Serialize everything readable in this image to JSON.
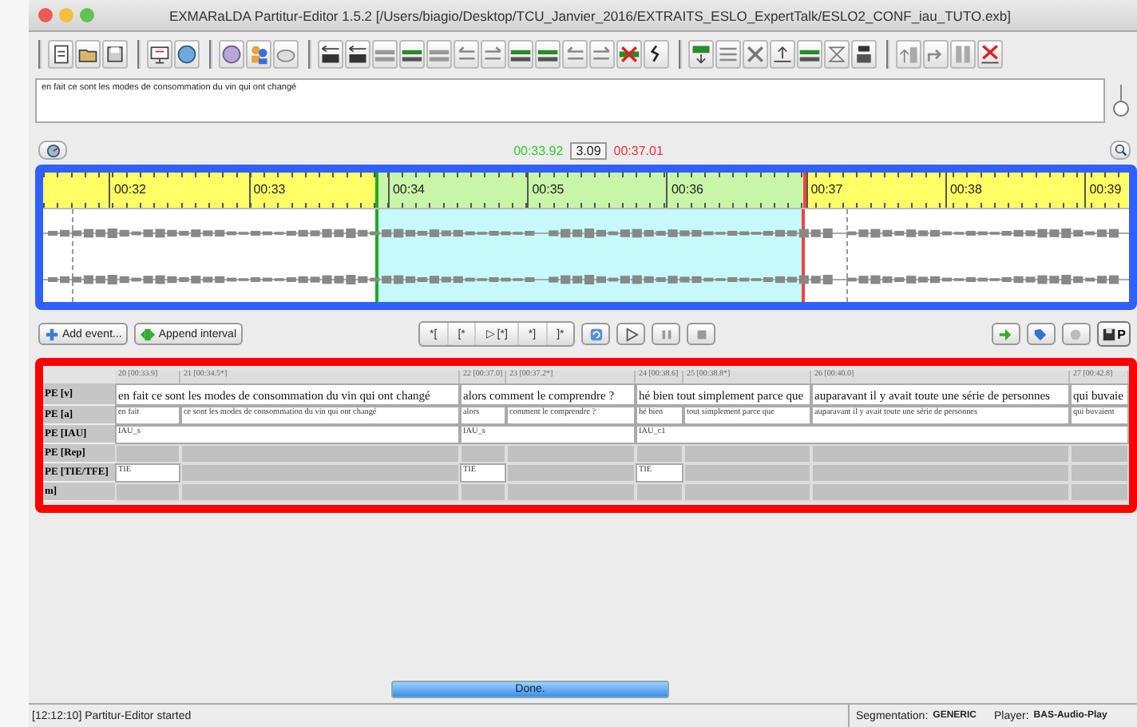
{
  "window": {
    "title": "EXMARaLDA Partitur-Editor 1.5.2 [/Users/biagio/Desktop/TCU_Janvier_2016/EXTRAITS_ESLO_ExpertTalk/ESLO2_CONF_iau_TUTO.exb]"
  },
  "transcript_field": {
    "value": "en fait ce sont les modes de consommation du vin qui ont changé"
  },
  "selection": {
    "start": "00:33.92",
    "length": "3.09",
    "end": "00:37.01"
  },
  "timeline": {
    "ticks": [
      "00:32",
      "00:33",
      "00:34",
      "00:35",
      "00:36",
      "00:37",
      "00:38",
      "00:39"
    ]
  },
  "buttons": [
    "Add event...",
    "Append interval"
  ],
  "segment_buttons": [
    "*[",
    "[*",
    "▷ [*]",
    "*]",
    "]*"
  ],
  "mode_button": {
    "label": "P"
  },
  "partitur": {
    "columns": [
      "20 [00:33.9]",
      "21 [00:34.5*]",
      "22 [00:37.0]",
      "23 [00:37.2*]",
      "24 [00:38.6]",
      "25 [00:38.8*]",
      "26 [00:40.0]",
      "27 [00:42.8]"
    ],
    "tiers": [
      {
        "label": "PE [v]",
        "kind": "large",
        "cells": [
          {
            "kind": "event",
            "text": "en fait ce sont les modes de consommation du vin qui ont changé"
          },
          {
            "kind": "continue"
          },
          {
            "kind": "event",
            "text": "alors comment le comprendre ?"
          },
          {
            "kind": "continue"
          },
          {
            "kind": "event",
            "text": "hé bien tout simplement parce que"
          },
          {
            "kind": "continue"
          },
          {
            "kind": "event",
            "text": "auparavant il y avait toute une série de personnes"
          },
          {
            "kind": "event",
            "text": "qui buvaie"
          }
        ]
      },
      {
        "label": "PE [a]",
        "kind": "small",
        "cells": [
          {
            "kind": "event",
            "text": "en fait"
          },
          {
            "kind": "event",
            "text": "ce sont les modes de consommation du vin qui ont changé"
          },
          {
            "kind": "event",
            "text": "alors"
          },
          {
            "kind": "event",
            "text": "comment le comprendre ?"
          },
          {
            "kind": "event",
            "text": "hé bien"
          },
          {
            "kind": "event",
            "text": "tout simplement parce que"
          },
          {
            "kind": "event",
            "text": "auparavant il y avait toute une série de personnes"
          },
          {
            "kind": "event",
            "text": "qui buvaient"
          }
        ]
      },
      {
        "label": "PE [IAU]",
        "kind": "small",
        "cells": [
          {
            "kind": "event",
            "text": "IAU_s"
          },
          {
            "kind": "continue"
          },
          {
            "kind": "event",
            "text": "IAU_s"
          },
          {
            "kind": "continue"
          },
          {
            "kind": "event",
            "text": "IAU_c1"
          },
          {
            "kind": "continue"
          },
          {
            "kind": "continue"
          },
          {
            "kind": "continue"
          }
        ]
      },
      {
        "label": "PE [Rep]",
        "kind": "small",
        "cells": [
          {
            "kind": "empty"
          },
          {
            "kind": "empty"
          },
          {
            "kind": "empty"
          },
          {
            "kind": "empty"
          },
          {
            "kind": "empty"
          },
          {
            "kind": "empty"
          },
          {
            "kind": "empty"
          },
          {
            "kind": "empty"
          }
        ]
      },
      {
        "label": "PE [TIE/TFE]",
        "kind": "small",
        "cells": [
          {
            "kind": "event",
            "text": "TIE"
          },
          {
            "kind": "empty"
          },
          {
            "kind": "event",
            "text": "TIE"
          },
          {
            "kind": "empty"
          },
          {
            "kind": "event",
            "text": "TIE"
          },
          {
            "kind": "empty"
          },
          {
            "kind": "empty"
          },
          {
            "kind": "empty"
          }
        ]
      },
      {
        "label": "m]",
        "kind": "small",
        "cells": [
          {
            "kind": "empty"
          },
          {
            "kind": "empty"
          },
          {
            "kind": "empty"
          },
          {
            "kind": "empty"
          },
          {
            "kind": "empty"
          },
          {
            "kind": "empty"
          },
          {
            "kind": "empty"
          },
          {
            "kind": "empty"
          }
        ]
      }
    ]
  },
  "progress": {
    "label": "Done.",
    "level": 1
  },
  "status_bar": {
    "message": "[12:12:10] Partitur-Editor started",
    "segmentation_label": "Segmentation:",
    "segmentation": "GENERIC",
    "player_label": "Player:",
    "player": "BAS-Audio-Play"
  }
}
